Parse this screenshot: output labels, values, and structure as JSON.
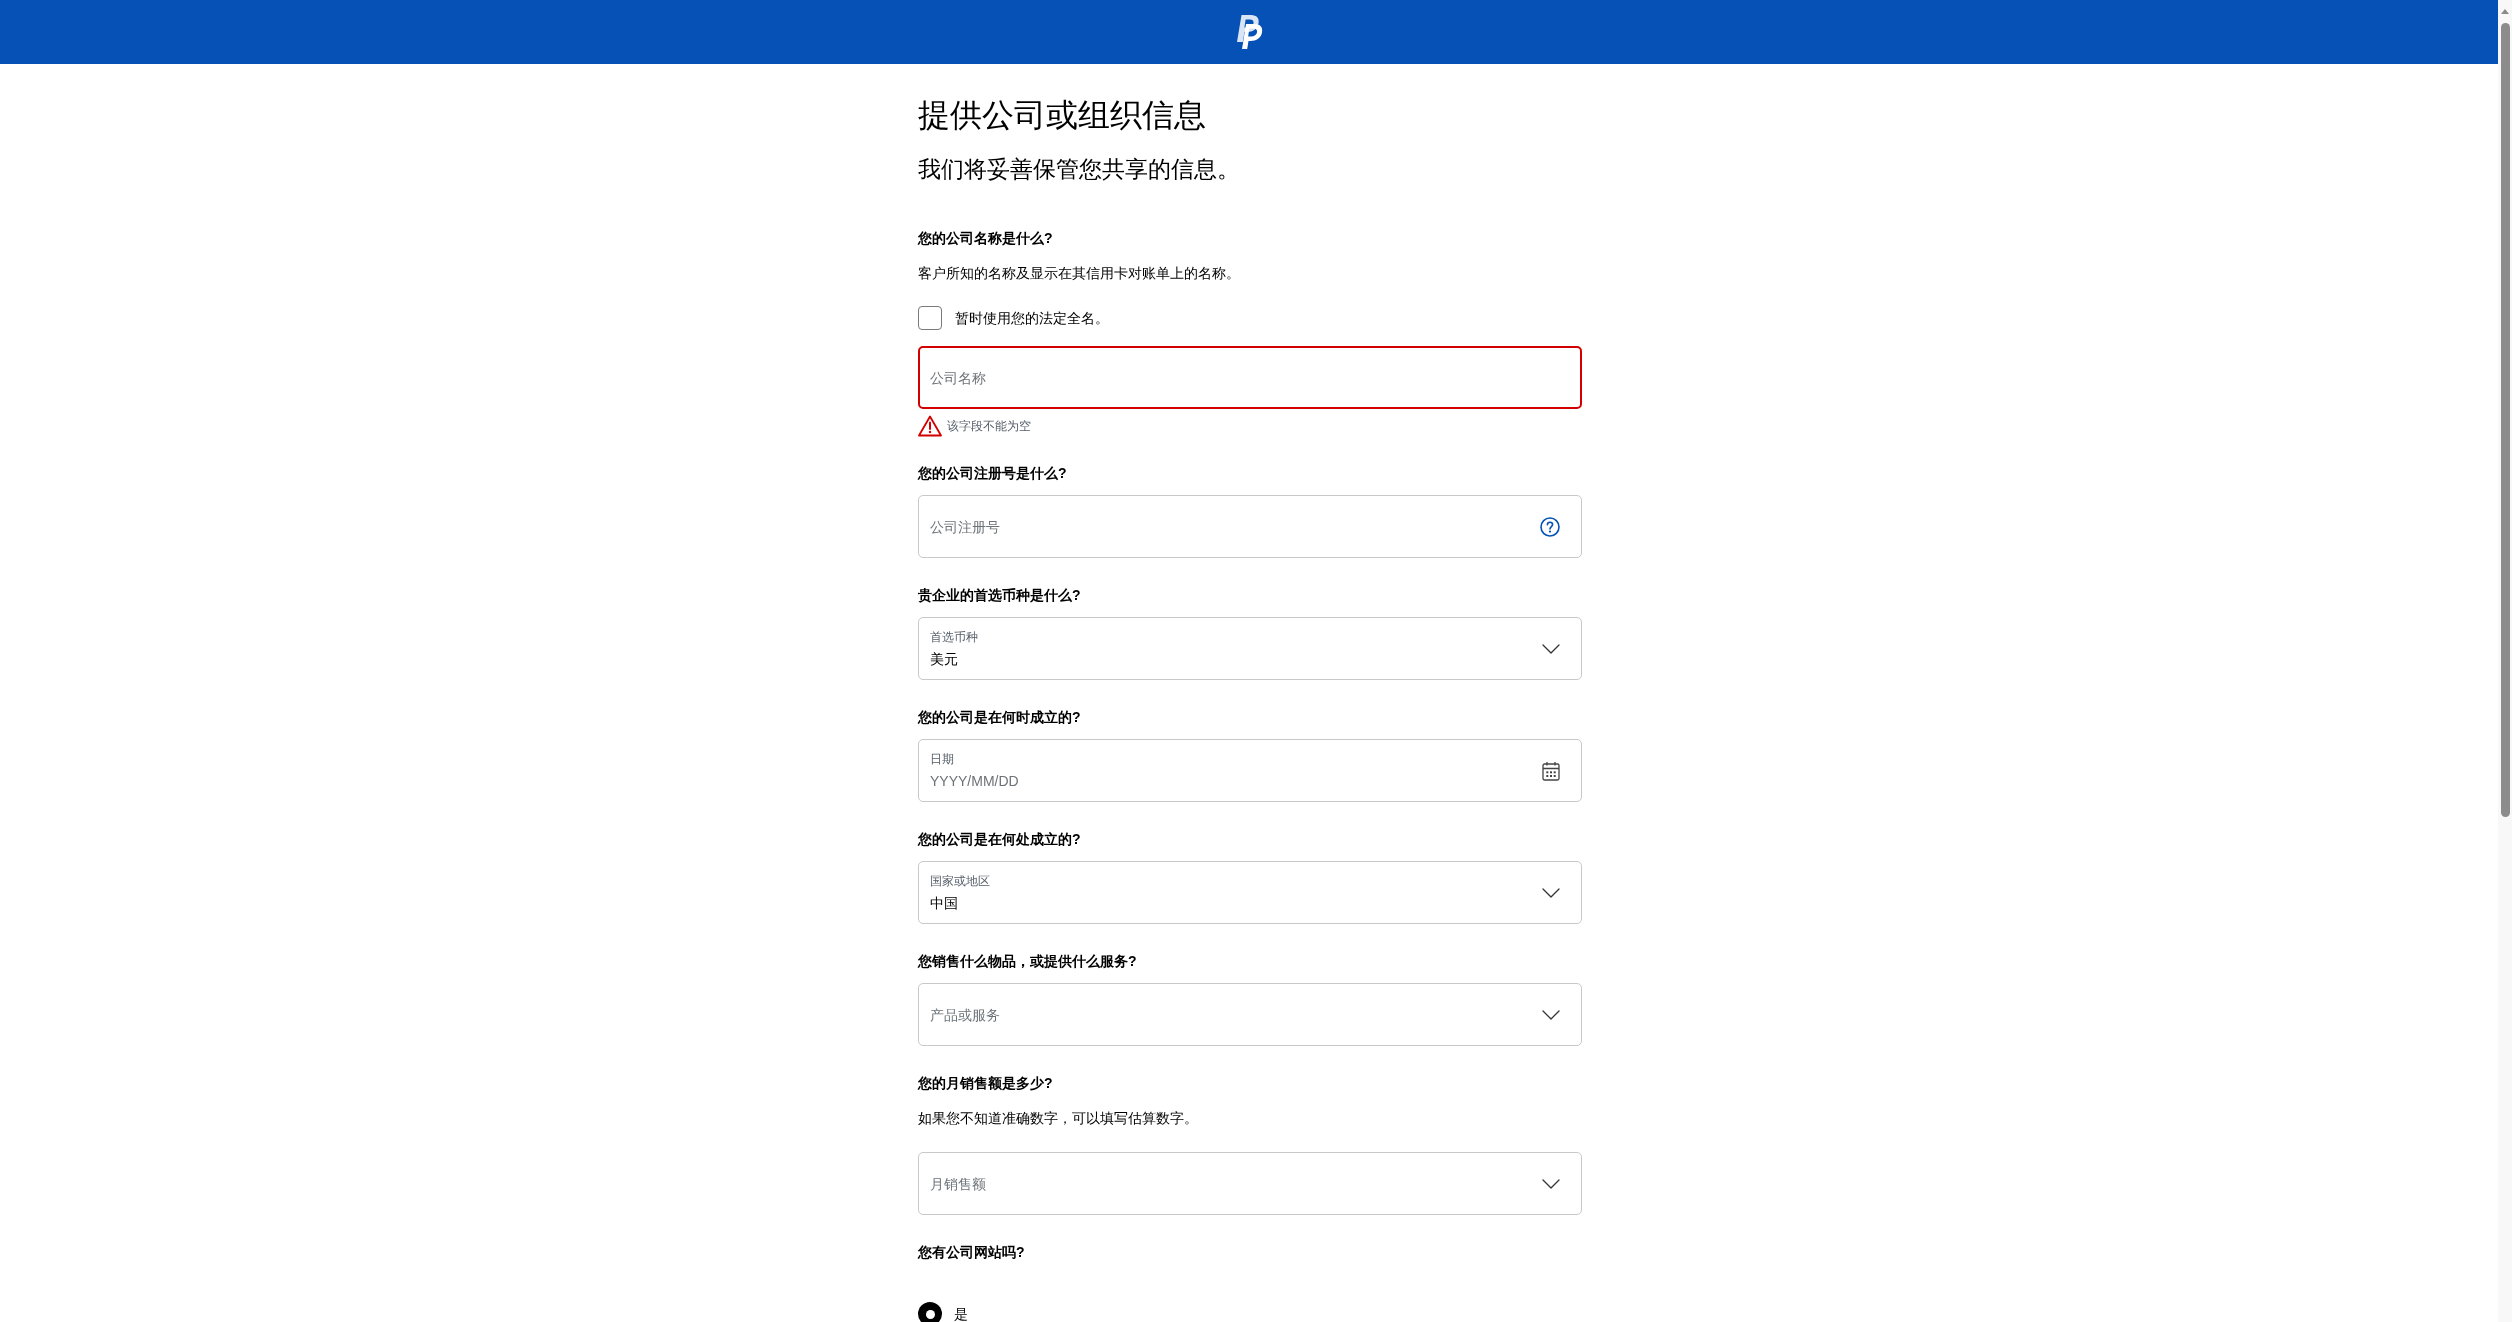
{
  "title": "提供公司或组织信息",
  "subtitle": "我们将妥善保管您共享的信息。",
  "questions": [
    {
      "question": "您的公司名称是什么?",
      "hint": "客户所知的名称及显示在其信用卡对账单上的名称。",
      "checkbox": {
        "label": "暂时使用您的法定全名。",
        "checked": false
      },
      "field": {
        "kind": "text",
        "placeholder": "公司名称",
        "error": "该字段不能为空"
      }
    },
    {
      "question": "您的公司注册号是什么?",
      "field": {
        "kind": "help",
        "placeholder": "公司注册号"
      }
    },
    {
      "question": "贵企业的首选币种是什么?",
      "field": {
        "kind": "select",
        "label": "首选币种",
        "value": "美元"
      }
    },
    {
      "question": "您的公司是在何时成立的?",
      "field": {
        "kind": "date",
        "label": "日期",
        "placeholder": "YYYY/MM/DD"
      }
    },
    {
      "question": "您的公司是在何处成立的?",
      "field": {
        "kind": "select",
        "label": "国家或地区",
        "value": "中国"
      }
    },
    {
      "question": "您销售什么物品，或提供什么服务?",
      "field": {
        "kind": "select",
        "placeholder": "产品或服务"
      }
    },
    {
      "question": "您的月销售额是多少?",
      "hint": "如果您不知道准确数字，可以填写估算数字。",
      "field": {
        "kind": "select",
        "placeholder": "月销售额"
      }
    },
    {
      "question": "您有公司网站吗?",
      "options": [
        {
          "label": "是",
          "selected": true
        }
      ]
    }
  ]
}
